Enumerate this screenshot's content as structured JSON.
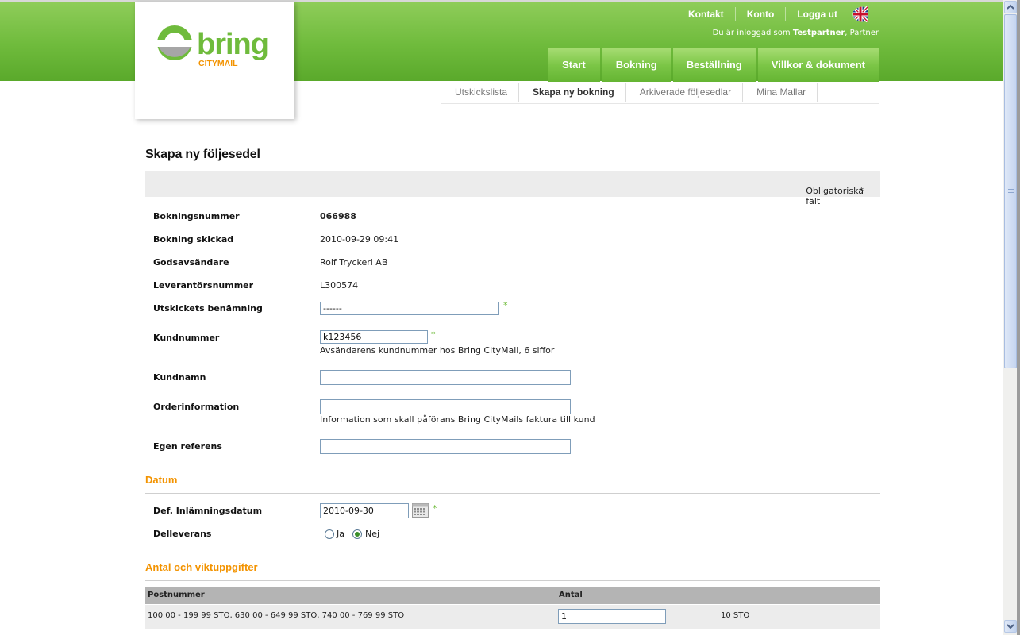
{
  "header": {
    "logo_text": "bring",
    "logo_sub": "CITYMAIL",
    "top_links": [
      "Kontakt",
      "Konto",
      "Logga ut"
    ],
    "flag_icon": "uk-flag-icon",
    "logged_in_prefix": "Du är inloggad som",
    "logged_in_user": "Testpartner",
    "logged_in_role": ", Partner",
    "main_nav": [
      "Start",
      "Bokning",
      "Beställning",
      "Villkor & dokument"
    ],
    "sub_nav": [
      "Utskickslista",
      "Skapa ny bokning",
      "Arkiverade följesedlar",
      "Mina Mallar"
    ],
    "sub_nav_active": "Skapa ny bokning"
  },
  "page": {
    "title": "Skapa ny följesedel",
    "required_note": "Obligatoriska fält",
    "required_star": "*"
  },
  "form": {
    "booking_number_label": "Bokningsnummer",
    "booking_number": "066988",
    "booking_sent_label": "Bokning skickad",
    "booking_sent": "2010-09-29 09:41",
    "sender_label": "Godsavsändare",
    "sender": "Rolf Tryckeri AB",
    "supplier_label": "Leverantörsnummer",
    "supplier": "L300574",
    "mailing_name_label": "Utskickets benämning",
    "mailing_name_value": "------",
    "customer_number_label": "Kundnummer",
    "customer_number_value": "k123456",
    "customer_number_hint": "Avsändarens kundnummer hos Bring CityMail, 6 siffor",
    "customer_name_label": "Kundnamn",
    "customer_name_value": "",
    "order_info_label": "Orderinformation",
    "order_info_value": "",
    "order_info_hint": "Information som skall påförans Bring CityMails faktura till kund",
    "own_ref_label": "Egen referens",
    "own_ref_value": ""
  },
  "date_section": {
    "title": "Datum",
    "delivery_date_label": "Def. Inlämningsdatum",
    "delivery_date_value": "2010-09-30",
    "partial_label": "Delleverans",
    "partial_yes": "Ja",
    "partial_no": "Nej",
    "partial_selected": "Nej"
  },
  "quantity_section": {
    "title": "Antal och viktuppgifter",
    "columns": [
      "Postnummer",
      "Antal"
    ],
    "rows": [
      {
        "postnummer": "100 00 - 199 99 STO, 630 00 - 649 99 STO, 740 00 - 769 99 STO",
        "antal": "1",
        "unit": "10 STO"
      }
    ]
  },
  "colors": {
    "brand_green": "#6fbb3c",
    "section_orange": "#f39300"
  }
}
